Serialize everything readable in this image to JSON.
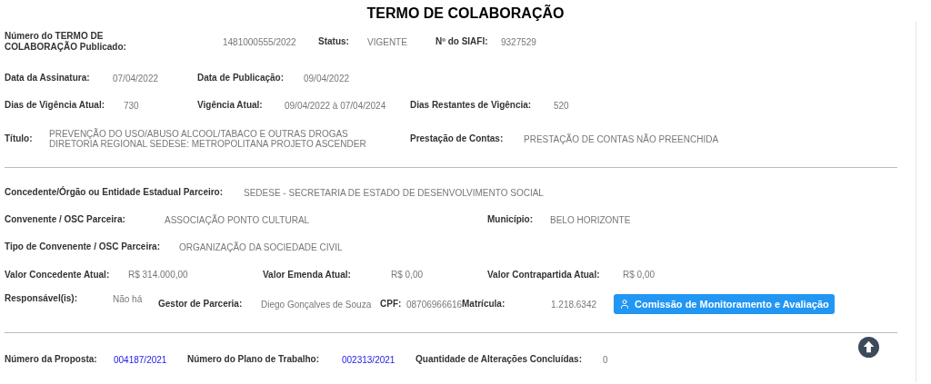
{
  "title": "TERMO DE COLABORAÇÃO",
  "sections": [
    {
      "rows": [
        {
          "fields": [
            {
              "kind": "pair",
              "label": "Número do TERMO DE COLABORAÇÃO Publicado:",
              "value": "1481000555/2022"
            },
            {
              "kind": "pair",
              "label": "Status:",
              "value": "VIGENTE"
            },
            {
              "kind": "pair",
              "label": "Nº do SIAFI:",
              "value": "9327529"
            }
          ]
        },
        {
          "fields": [
            {
              "kind": "pair",
              "label": "Data da Assinatura:",
              "value": "07/04/2022"
            },
            {
              "kind": "pair",
              "label": "Data de Publicação:",
              "value": "09/04/2022"
            }
          ]
        },
        {
          "fields": [
            {
              "kind": "pair",
              "label": "Dias de Vigência Atual:",
              "value": "730"
            },
            {
              "kind": "pair",
              "label": "Vigência Atual:",
              "value": "09/04/2022 à 07/04/2024"
            },
            {
              "kind": "pair",
              "label": "Dias Restantes de Vigência:",
              "value": "520"
            }
          ]
        },
        {
          "fields": [
            {
              "kind": "pair",
              "label": "Título:",
              "value": "PREVENÇÃO DO USO/ABUSO ALCOOL/TABACO E OUTRAS DROGAS DIRETORIA REGIONAL SEDESE: METROPOLITANA PROJETO ASCENDER"
            },
            {
              "kind": "pair",
              "label": "Prestação de Contas:",
              "value": "PRESTAÇÃO DE CONTAS NÃO PREENCHIDA"
            }
          ]
        }
      ]
    },
    {
      "rows": [
        {
          "fields": [
            {
              "kind": "pair",
              "label": "Concedente/Órgão ou Entidade Estadual Parceiro:",
              "value": "SEDESE - SECRETARIA DE ESTADO DE DESENVOLVIMENTO SOCIAL"
            }
          ]
        },
        {
          "fields": [
            {
              "kind": "pair",
              "label": "Convenente / OSC Parceira:",
              "value": "ASSOCIAÇÃO PONTO CULTURAL"
            },
            {
              "kind": "pair",
              "label": "Município:",
              "value": "BELO HORIZONTE"
            }
          ]
        },
        {
          "fields": [
            {
              "kind": "pair",
              "label": "Tipo de Convenente / OSC Parceira:",
              "value": "ORGANIZAÇÃO DA SOCIEDADE CIVIL"
            }
          ]
        },
        {
          "fields": [
            {
              "kind": "pair",
              "label": "Valor Concedente Atual:",
              "value": "R$ 314.000,00"
            },
            {
              "kind": "pair",
              "label": "Valor Emenda Atual:",
              "value": "R$ 0,00"
            },
            {
              "kind": "pair",
              "label": "Valor Contrapartida Atual:",
              "value": "R$ 0,00"
            }
          ]
        },
        {
          "fields": [
            {
              "kind": "pair",
              "label": "Responsável(is):",
              "value": "Não há"
            },
            {
              "kind": "pair",
              "label": "Gestor de Parceria:",
              "value": "Diego Gonçalves de Souza"
            },
            {
              "kind": "pair",
              "label": "CPF:",
              "value": "08706966616"
            },
            {
              "kind": "pair",
              "label": "Matrícula:",
              "value": "1.218.6342"
            },
            {
              "kind": "button",
              "label": "Comissão de Monitoramento e Avaliação"
            }
          ]
        }
      ]
    },
    {
      "rows": [
        {
          "fields": [
            {
              "kind": "link",
              "label": "Número da Proposta:",
              "value": "004187/2021"
            },
            {
              "kind": "link",
              "label": "Número do Plano de Trabalho:",
              "value": "002313/2021"
            },
            {
              "kind": "pair",
              "label": "Quantidade de Alterações Concluídas:",
              "value": "0"
            }
          ]
        }
      ]
    }
  ]
}
